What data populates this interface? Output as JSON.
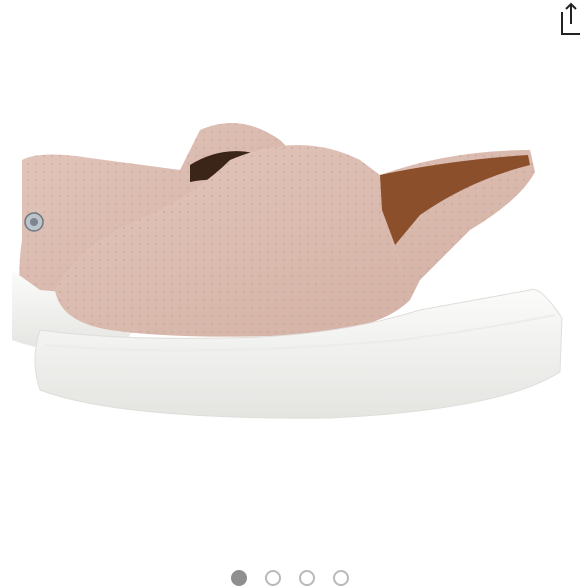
{
  "viewer": {
    "image": {
      "subject": "pink-perforated-slip-on-platform-sneakers",
      "icon": "product-photo"
    },
    "share": {
      "icon": "share-icon"
    },
    "pager": {
      "total": 4,
      "active_index": 0
    }
  },
  "colors": {
    "background": "#ffffff",
    "suede": "#dcbcb0",
    "sole": "#f5f5f3",
    "dot_active": "#8f8f8f",
    "dot_inactive": "#b9b9b9"
  }
}
